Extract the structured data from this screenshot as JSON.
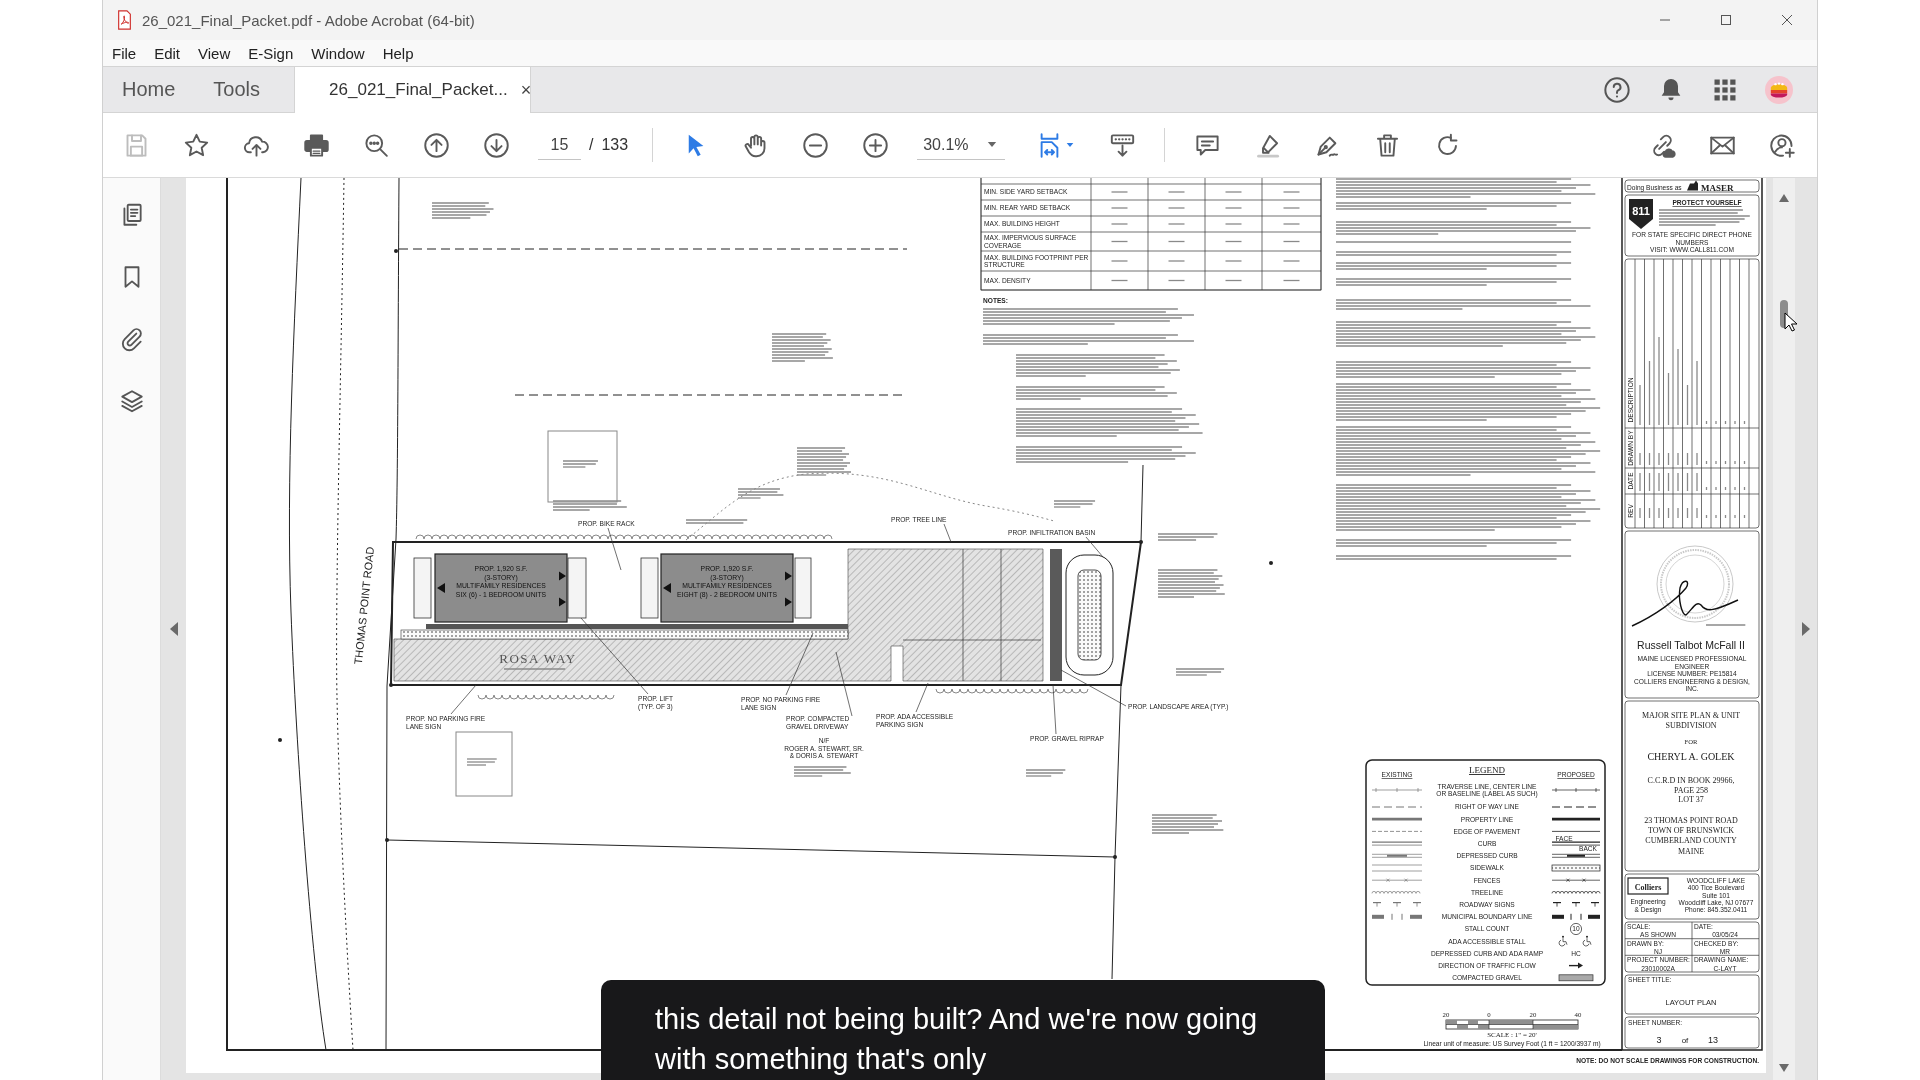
{
  "window": {
    "title": "26_021_Final_Packet.pdf - Adobe Acrobat (64-bit)"
  },
  "menu": [
    "File",
    "Edit",
    "View",
    "E-Sign",
    "Window",
    "Help"
  ],
  "tabs": [
    {
      "label": "Home",
      "kind": "nav",
      "selected": false
    },
    {
      "label": "Tools",
      "kind": "nav",
      "selected": false
    },
    {
      "label": "26_021_Final_Packet...",
      "kind": "document",
      "selected": true,
      "close": "×"
    }
  ],
  "toolbar": {
    "page": "15",
    "page_separator": "/",
    "page_count": "133",
    "tools": [
      {
        "kind": "select",
        "selected": true
      },
      {
        "kind": "hand",
        "selected": false
      }
    ],
    "zoom": "30.1%"
  },
  "sheet": {
    "zoning_rows": [
      {
        "lines": [
          "MIN. SIDE YARD SETBACK"
        ]
      },
      {
        "lines": [
          "MIN. REAR YARD SETBACK"
        ]
      },
      {
        "lines": [
          "MAX. BUILDING HEIGHT"
        ]
      },
      {
        "lines": [
          "MAX. IMPERVIOUS SURFACE",
          "COVERAGE"
        ]
      },
      {
        "lines": [
          "MAX. BUILDING FOOTPRINT PER",
          "STRUCTURE"
        ]
      },
      {
        "lines": [
          "MAX. DENSITY"
        ]
      }
    ],
    "notes_heading": "NOTES:",
    "road_label": "THOMAS POINT ROAD",
    "street_label": "ROSA WAY",
    "buildings": [
      {
        "lines": [
          "PROP. 1,920 S.F.",
          "(3-STORY)",
          "MULTIFAMILY RESIDENCES",
          "SIX (6) - 1 BEDROOM UNITS"
        ]
      },
      {
        "lines": [
          "PROP. 1,920 S.F.",
          "(3-STORY)",
          "MULTIFAMILY RESIDENCES",
          "EIGHT (8) - 2 BEDROOM UNITS"
        ]
      }
    ],
    "callouts": [
      {
        "lines": [
          "PROP. BIKE RACK"
        ]
      },
      {
        "lines": [
          "PROP. TREE LINE"
        ]
      },
      {
        "lines": [
          "PROP. INFILTRATION BASIN"
        ]
      },
      {
        "lines": [
          "PROP. LIFT",
          "(TYP. OF 3)"
        ]
      },
      {
        "lines": [
          "PROP. NO PARKING FIRE",
          "LANE SIGN"
        ]
      },
      {
        "lines": [
          "PROP. COMPACTED",
          "GRAVEL DRIVEWAY"
        ]
      },
      {
        "lines": [
          "PROP. ADA ACCESSIBLE",
          "PARKING SIGN"
        ]
      },
      {
        "lines": [
          "PROP. LANDSCAPE AREA (TYP.)"
        ]
      },
      {
        "lines": [
          "PROP. GRAVEL RIPRAP"
        ]
      },
      {
        "lines": [
          "PROP. NO PARKING FIRE",
          "LANE SIGN"
        ]
      },
      {
        "lines": [
          "N/F",
          "ROGER A. STEWART, SR.",
          "& DORIS A. STEWART"
        ]
      }
    ],
    "title_block": {
      "doing_business": "Doing Business as",
      "firm_logo": "MASER",
      "dig_logo": "811",
      "dig_heading": "PROTECT YOURSELF",
      "dig_footer": [
        "FOR STATE SPECIFIC DIRECT PHONE NUMBERS",
        "VISIT: WWW.CALL811.COM"
      ],
      "revision_headers": [
        "DESCRIPTION",
        "DRAWN BY",
        "DATE",
        "REV"
      ],
      "engineer": "Russell Talbot McFall II",
      "engineer_details": [
        "MAINE LICENSED PROFESSIONAL ENGINEER",
        "LICENSE NUMBER: PE15814",
        "COLLIERS ENGINEERING & DESIGN, INC."
      ],
      "project_title": [
        "MAJOR SITE PLAN & UNIT",
        "SUBDIVISION"
      ],
      "for": "FOR",
      "client": "CHERYL A. GOLEK",
      "deed": [
        "C.C.R.D IN BOOK 29966,",
        "PAGE 258",
        "LOT 37"
      ],
      "address": [
        "23 THOMAS POINT ROAD",
        "TOWN OF BRUNSWICK",
        "CUMBERLAND COUNTY",
        "MAINE"
      ],
      "company_logo": "Colliers",
      "company_tagline": [
        "Engineering",
        "& Design"
      ],
      "office": [
        "WOODCLIFF LAKE",
        "400 Tice Boulevard",
        "Suite 101",
        "Woodcliff Lake, NJ 07677",
        "Phone: 845.352.0411"
      ],
      "info": [
        {
          "label": "SCALE:",
          "value": "AS SHOWN"
        },
        {
          "label": "DATE:",
          "value": "03/05/24"
        },
        {
          "label": "DRAWN BY:",
          "value": "NJ"
        },
        {
          "label": "CHECKED BY:",
          "value": "MR"
        },
        {
          "label": "PROJECT NUMBER:",
          "value": "23010002A"
        },
        {
          "label": "DRAWING NAME:",
          "value": "C-LAYT"
        }
      ],
      "sheet_title_label": "SHEET TITLE:",
      "sheet_title": "LAYOUT PLAN",
      "sheet_number_label": "SHEET NUMBER:",
      "sheet_number": "3",
      "sheet_of": "of",
      "sheet_total": "13"
    },
    "legend": {
      "title": "LEGEND",
      "existing": "EXISTING",
      "proposed": "PROPOSED",
      "rows": [
        {
          "kind": "traverse",
          "lines": [
            "TRAVERSE LINE, CENTER LINE",
            "OR BASELINE (LABEL AS SUCH)"
          ]
        },
        {
          "kind": "dashed",
          "lines": [
            "RIGHT OF WAY LINE"
          ]
        },
        {
          "kind": "heavy",
          "lines": [
            "PROPERTY LINE"
          ]
        },
        {
          "kind": "pavement",
          "lines": [
            "EDGE OF PAVEMENT"
          ]
        },
        {
          "kind": "curb",
          "lines": [
            "CURB"
          ],
          "marks": [
            "FACE",
            "BACK"
          ]
        },
        {
          "kind": "depressed",
          "lines": [
            "DEPRESSED CURB"
          ]
        },
        {
          "kind": "sidewalk",
          "lines": [
            "SIDEWALK"
          ]
        },
        {
          "kind": "fence",
          "lines": [
            "FENCES"
          ]
        },
        {
          "kind": "tree",
          "lines": [
            "TREELINE"
          ]
        },
        {
          "kind": "sign",
          "lines": [
            "ROADWAY SIGNS"
          ]
        },
        {
          "kind": "boundary",
          "lines": [
            "MUNICIPAL BOUNDARY LINE"
          ]
        },
        {
          "kind": "stall",
          "lines": [
            "STALL COUNT"
          ],
          "marks": [
            "10"
          ]
        },
        {
          "kind": "ada",
          "lines": [
            "ADA ACCESSIBLE STALL"
          ]
        },
        {
          "kind": "ramp",
          "lines": [
            "DEPRESSED CURB AND ADA RAMP"
          ],
          "marks": [
            "HC"
          ]
        },
        {
          "kind": "arrow",
          "lines": [
            "DIRECTION OF TRAFFIC FLOW"
          ]
        },
        {
          "kind": "gravel",
          "lines": [
            "COMPACTED GRAVEL"
          ]
        }
      ]
    },
    "scale": {
      "ticks": [
        "20",
        "0",
        "20",
        "40"
      ],
      "label": "SCALE : 1\" = 20'",
      "unit_note": "Linear unit of measure: US Survey Foot (1 ft = 1200/3937 m)"
    },
    "footer_note": "NOTE: DO NOT SCALE DRAWINGS FOR CONSTRUCTION."
  },
  "caption": {
    "lines": [
      "this detail not being built? And we're now going",
      "with something that's only"
    ]
  }
}
